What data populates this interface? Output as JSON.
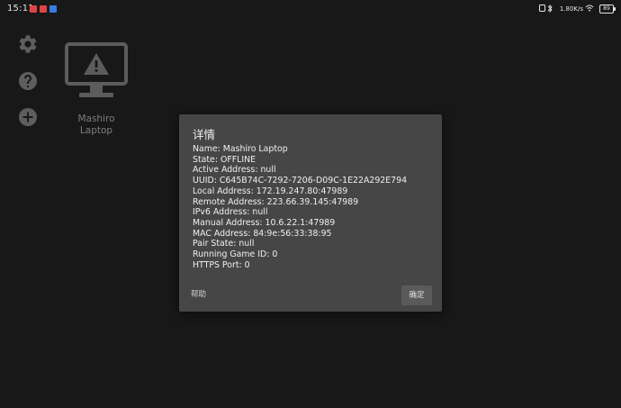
{
  "status_bar": {
    "time": "15:11",
    "network_speed": "1.80K/s",
    "battery_level": "89",
    "notification_colors": [
      "#e04545",
      "#e04545",
      "#3a7de0"
    ]
  },
  "sidebar": {
    "items": [
      {
        "icon": "gear-icon"
      },
      {
        "icon": "help-icon"
      },
      {
        "icon": "add-icon"
      }
    ]
  },
  "computer": {
    "name_line1": "Mashiro",
    "name_line2": "Laptop",
    "icon": "monitor-warning-icon"
  },
  "dialog": {
    "title": "详情",
    "lines": [
      "Name: Mashiro Laptop",
      "State: OFFLINE",
      "Active Address: null",
      "UUID: C645B74C-7292-7206-D09C-1E22A292E794",
      "Local Address: 172.19.247.80:47989",
      "Remote Address: 223.66.39.145:47989",
      "IPv6 Address: null",
      "Manual Address: 10.6.22.1:47989",
      "MAC Address: 84:9e:56:33:38:95",
      "Pair State: null",
      "Running Game ID: 0",
      "HTTPS Port: 0"
    ],
    "help_label": "帮助",
    "ok_label": "确定"
  },
  "colors": {
    "background": "#181818",
    "dialog_bg": "#464646",
    "icon_gray": "#5e5e5e"
  }
}
